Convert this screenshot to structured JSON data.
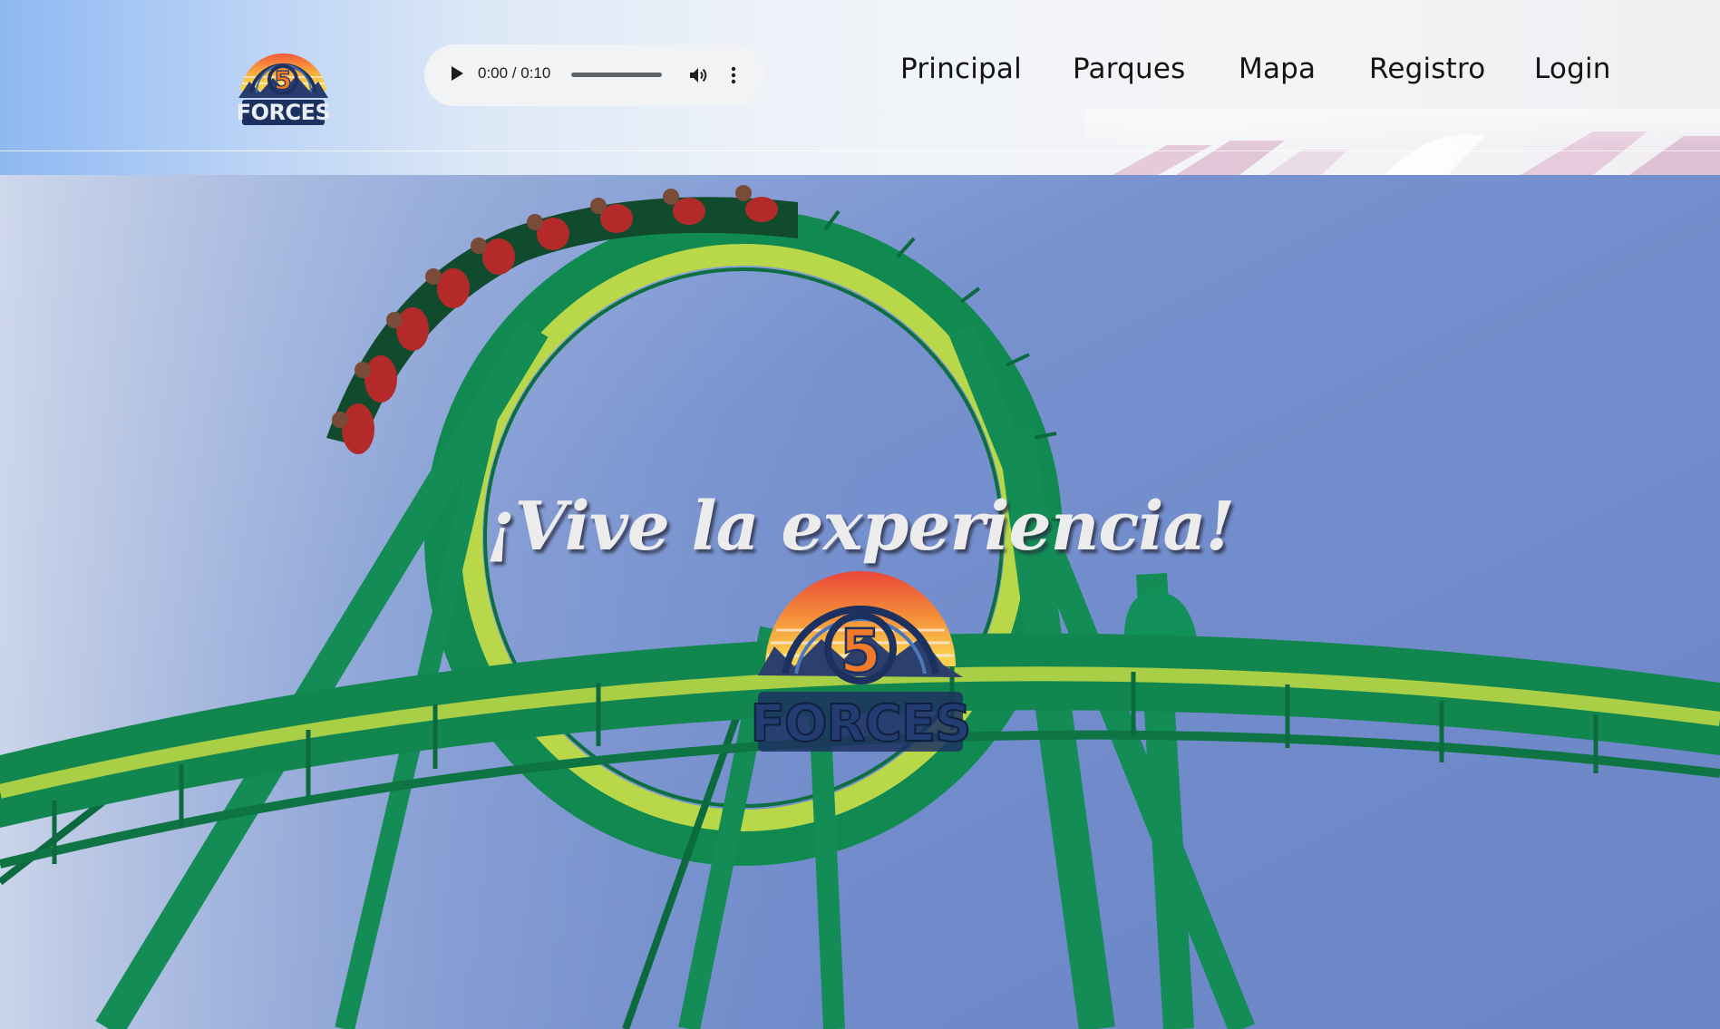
{
  "header": {
    "logo": {
      "name": "5-forces-logo",
      "text_a": "5",
      "text_b": "FORCES"
    },
    "audio": {
      "time": "0:00 / 0:10",
      "play_icon": "play-icon",
      "volume_icon": "volume-icon",
      "menu_icon": "more-vertical-icon"
    },
    "nav": {
      "items": [
        {
          "label": "Principal"
        },
        {
          "label": "Parques"
        },
        {
          "label": "Mapa"
        },
        {
          "label": "Registro"
        },
        {
          "label": "Login"
        }
      ]
    }
  },
  "hero": {
    "title": "¡Vive la experiencia!",
    "logo": {
      "text_a": "5",
      "text_b": "FORCES"
    },
    "image_subject": "green roller coaster loop with riders against blue sky"
  },
  "colors": {
    "nav_text": "#141414",
    "hero_title": "#ececec",
    "track_green": "#118a52",
    "track_yellow": "#b8d84a",
    "sky": "#7a94cf",
    "logo_orange": "#f07a2a",
    "logo_navy": "#1d3160"
  }
}
